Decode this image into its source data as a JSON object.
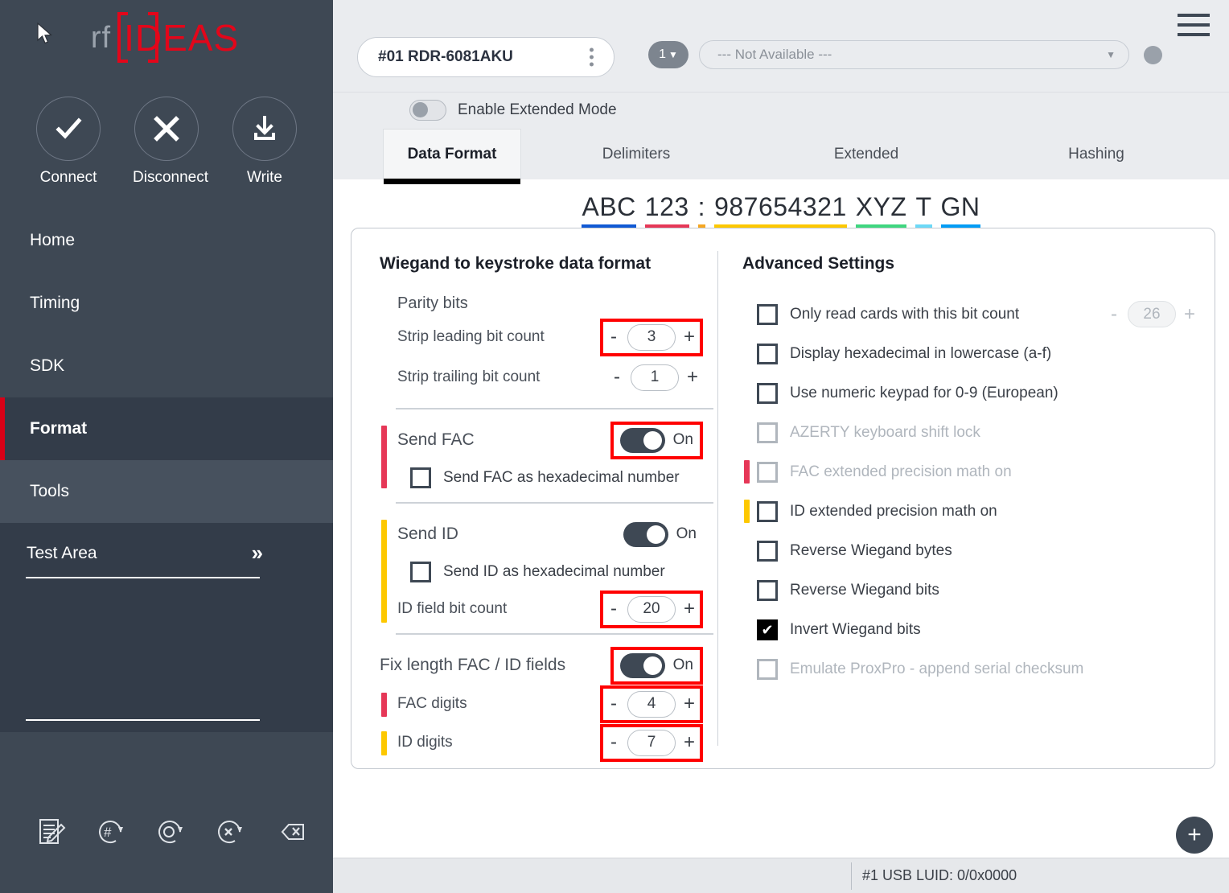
{
  "sidebar": {
    "logo": {
      "prefix": "rf",
      "brand": "IDEAS"
    },
    "actions": [
      {
        "label": "Connect",
        "icon": "check-icon"
      },
      {
        "label": "Disconnect",
        "icon": "close-icon"
      },
      {
        "label": "Write",
        "icon": "download-icon"
      }
    ],
    "nav": [
      {
        "label": "Home"
      },
      {
        "label": "Timing"
      },
      {
        "label": "SDK"
      },
      {
        "label": "Format"
      },
      {
        "label": "Tools"
      }
    ],
    "test_area": {
      "label": "Test Area",
      "expand": "››"
    },
    "bottom_icons": [
      "document-edit-icon",
      "hash-rotate-icon",
      "circle-rotate-icon",
      "x-rotate-icon",
      "backspace-icon"
    ]
  },
  "topbar": {
    "device": "#01 RDR-6081AKU",
    "kebab": "more-options",
    "index_badge": "1",
    "dropdown_value": "--- Not Available ---"
  },
  "tabsection": {
    "extended_mode_label": "Enable Extended Mode",
    "extended_mode_on": false,
    "tabs": [
      {
        "label": "Data Format",
        "active": true
      },
      {
        "label": "Delimiters",
        "active": false
      },
      {
        "label": "Extended",
        "active": false
      },
      {
        "label": "Hashing",
        "active": false
      }
    ]
  },
  "preview": {
    "segments": [
      {
        "text": "ABC",
        "color": "#1059d4"
      },
      {
        "text": "123",
        "color": "#e63757"
      },
      {
        "text": ":",
        "color": "#f5a623"
      },
      {
        "text": "987654321",
        "color": "#fdc800"
      },
      {
        "text": "XYZ",
        "color": "#3fd67f"
      },
      {
        "text": "T",
        "color": "#6cd9f7"
      },
      {
        "text": "GN",
        "color": "#029cf5"
      }
    ]
  },
  "left_panel": {
    "title": "Wiegand to keystroke data format",
    "parity_title": "Parity bits",
    "strip_leading": {
      "label": "Strip leading bit count",
      "value": "3",
      "minus": "-",
      "plus": "+",
      "highlighted": true
    },
    "strip_trailing": {
      "label": "Strip trailing bit count",
      "value": "1",
      "minus": "-",
      "plus": "+",
      "highlighted": false
    },
    "send_fac": {
      "label": "Send FAC",
      "toggle_state": "On",
      "toggle_on": true,
      "highlighted": true,
      "accent": "#e63757",
      "hex_label": "Send FAC as hexadecimal number",
      "hex_checked": false
    },
    "send_id": {
      "label": "Send ID",
      "toggle_state": "On",
      "toggle_on": true,
      "highlighted": false,
      "accent": "#fdc800",
      "hex_label": "Send ID as hexadecimal number",
      "hex_checked": false,
      "bit_count": {
        "label": "ID field bit count",
        "value": "20",
        "minus": "-",
        "plus": "+",
        "highlighted": true
      }
    },
    "fix_length": {
      "label": "Fix length FAC / ID fields",
      "toggle_state": "On",
      "toggle_on": true,
      "highlighted": true,
      "fac_digits": {
        "label": "FAC digits",
        "value": "4",
        "minus": "-",
        "plus": "+",
        "accent": "#e63757",
        "highlighted": true
      },
      "id_digits": {
        "label": "ID digits",
        "value": "7",
        "minus": "-",
        "plus": "+",
        "accent": "#fdc800",
        "highlighted": true
      }
    }
  },
  "right_panel": {
    "title": "Advanced Settings",
    "items": [
      {
        "label": "Only read cards with this bit count",
        "checked": false,
        "disabled": false,
        "accent": null,
        "stepper": {
          "value": "26",
          "minus": "-",
          "plus": "+",
          "disabled": true
        }
      },
      {
        "label": "Display hexadecimal in lowercase (a-f)",
        "checked": false,
        "disabled": false,
        "accent": null
      },
      {
        "label": "Use numeric keypad for 0-9 (European)",
        "checked": false,
        "disabled": false,
        "accent": null
      },
      {
        "label": "AZERTY keyboard shift lock",
        "checked": false,
        "disabled": true,
        "accent": null
      },
      {
        "label": "FAC extended precision math on",
        "checked": false,
        "disabled": true,
        "accent": "#e63757"
      },
      {
        "label": "ID extended precision math on",
        "checked": false,
        "disabled": false,
        "accent": "#fdc800"
      },
      {
        "label": "Reverse Wiegand bytes",
        "checked": false,
        "disabled": false,
        "accent": null
      },
      {
        "label": "Reverse Wiegand bits",
        "checked": false,
        "disabled": false,
        "accent": null
      },
      {
        "label": "Invert Wiegand bits",
        "checked": true,
        "disabled": false,
        "accent": null
      },
      {
        "label": "Emulate ProxPro - append serial checksum",
        "checked": false,
        "disabled": true,
        "accent": null
      }
    ]
  },
  "fab": {
    "label": "+"
  },
  "statusbar": {
    "text": "#1 USB LUID: 0/0x0000"
  },
  "colors": {
    "sidebar_bg": "#3e4854",
    "sidebar_active": "#333c49",
    "brand_red": "#e3061a",
    "accent_red": "#d90017",
    "highlight": "#ff0000"
  }
}
